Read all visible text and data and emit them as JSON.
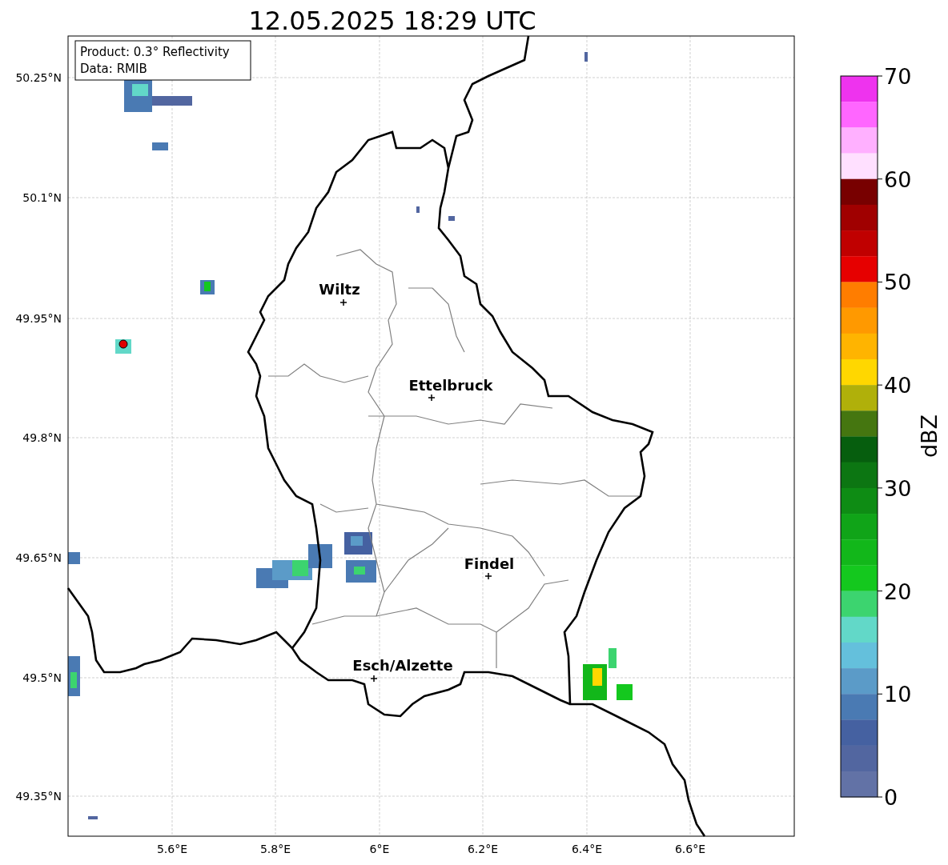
{
  "title": "12.05.2025 18:29 UTC",
  "map": {
    "info_box": [
      "Product: 0.3° Reflectivity",
      "Data: RMIB"
    ],
    "lat_ticks": [
      "50.25°N",
      "50.1°N",
      "49.95°N",
      "49.8°N",
      "49.65°N",
      "49.5°N",
      "49.35°N"
    ],
    "lon_ticks": [
      "5.6°E",
      "5.8°E",
      "6°E",
      "6.2°E",
      "6.4°E",
      "6.6°E"
    ],
    "cities": [
      {
        "name": "Wiltz"
      },
      {
        "name": "Ettelbruck"
      },
      {
        "name": "Findel"
      },
      {
        "name": "Esch/Alzette"
      }
    ]
  },
  "colorbar": {
    "label": "dBZ",
    "ticks": [
      "70",
      "60",
      "50",
      "40",
      "30",
      "20",
      "10",
      "0"
    ],
    "segments": [
      {
        "color": "#ee33ee"
      },
      {
        "color": "#ff66ff"
      },
      {
        "color": "#ffb0ff"
      },
      {
        "color": "#ffe0ff"
      },
      {
        "color": "#780000"
      },
      {
        "color": "#a00000"
      },
      {
        "color": "#c00000"
      },
      {
        "color": "#e60000"
      },
      {
        "color": "#ff7d00"
      },
      {
        "color": "#ff9900"
      },
      {
        "color": "#ffb400"
      },
      {
        "color": "#ffd700"
      },
      {
        "color": "#b0b00a"
      },
      {
        "color": "#457610"
      },
      {
        "color": "#065e0e"
      },
      {
        "color": "#0c7612"
      },
      {
        "color": "#0e8c14"
      },
      {
        "color": "#10a418"
      },
      {
        "color": "#12b71a"
      },
      {
        "color": "#14c81e"
      },
      {
        "color": "#3cd46f"
      },
      {
        "color": "#62d8c8"
      },
      {
        "color": "#64c0dc"
      },
      {
        "color": "#5b9bc8"
      },
      {
        "color": "#4a7ab3"
      },
      {
        "color": "#4561a1"
      },
      {
        "color": "#5266a0"
      },
      {
        "color": "#6272a6"
      }
    ]
  }
}
